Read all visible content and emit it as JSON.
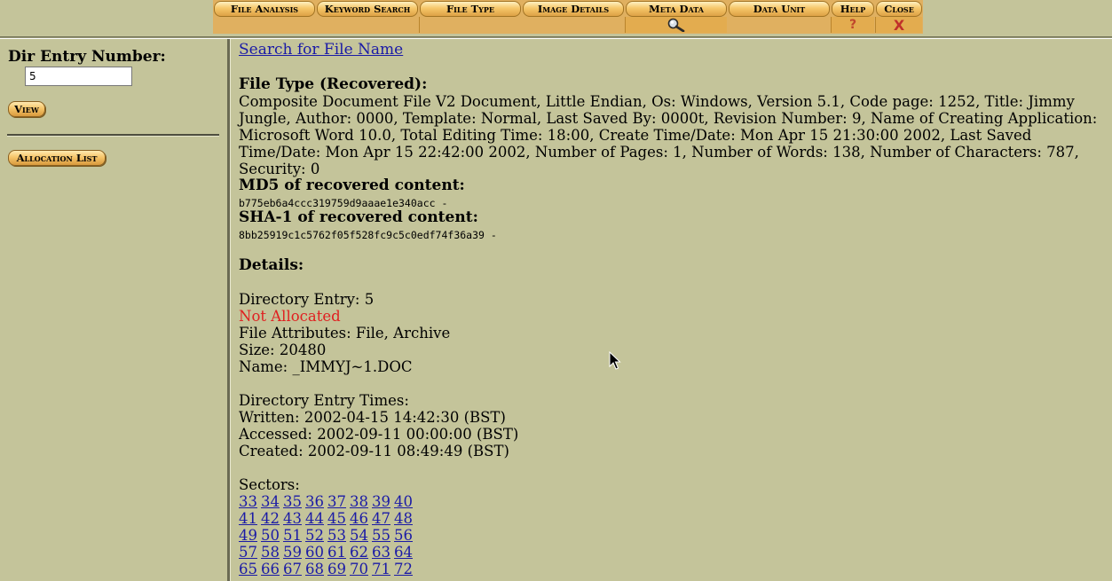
{
  "toolbar": {
    "tabs": [
      "File Analysis",
      "Keyword Search",
      "File Type",
      "Image Details",
      "Meta Data",
      "Data Unit",
      "Help",
      "Close"
    ],
    "help_symbol": "?",
    "close_symbol": "X"
  },
  "left": {
    "label": "Dir Entry Number:",
    "entry_value": "5",
    "view_button": "View",
    "allocation_button": "Allocation List"
  },
  "main": {
    "search_link": "Search for File Name",
    "file_type_heading": "File Type (Recovered):",
    "file_type_text": "Composite Document File V2 Document, Little Endian, Os: Windows, Version 5.1, Code page: 1252, Title: Jimmy Jungle, Author: 0000, Template: Normal, Last Saved By: 0000t, Revision Number: 9, Name of Creating Application: Microsoft Word 10.0, Total Editing Time: 18:00, Create Time/Date: Mon Apr 15 21:30:00 2002, Last Saved Time/Date: Mon Apr 15 22:42:00 2002, Number of Pages: 1, Number of Words: 138, Number of Characters: 787, Security: 0",
    "md5_heading": "MD5 of recovered content:",
    "md5_value": "b775eb6a4ccc319759d9aaae1e340acc  -",
    "sha1_heading": "SHA-1 of recovered content:",
    "sha1_value": "8bb25919c1c5762f05f528fc9c5c0edf74f36a39  -",
    "details_heading": "Details:",
    "directory_entry": "Directory Entry: 5",
    "allocation_status": "Not Allocated",
    "file_attributes": "File Attributes: File, Archive",
    "size": "Size: 20480",
    "name": "Name: _IMMYJ~1.DOC",
    "times_heading": "Directory Entry Times:",
    "written": "Written: 2002-04-15 14:42:30 (BST)",
    "accessed": "Accessed: 2002-09-11 00:00:00 (BST)",
    "created": "Created: 2002-09-11 08:49:49 (BST)",
    "sectors_heading": "Sectors:",
    "sectors": [
      [
        "33",
        "34",
        "35",
        "36",
        "37",
        "38",
        "39",
        "40"
      ],
      [
        "41",
        "42",
        "43",
        "44",
        "45",
        "46",
        "47",
        "48"
      ],
      [
        "49",
        "50",
        "51",
        "52",
        "53",
        "54",
        "55",
        "56"
      ],
      [
        "57",
        "58",
        "59",
        "60",
        "61",
        "62",
        "63",
        "64"
      ],
      [
        "65",
        "66",
        "67",
        "68",
        "69",
        "70",
        "71",
        "72"
      ]
    ]
  },
  "colors": {
    "background": "#c4c49a",
    "toolbar": "#e0b060",
    "link": "#1a1aa6",
    "not_allocated": "#e02020"
  },
  "icons": [
    "magnifier-icon",
    "mouse-cursor-icon"
  ]
}
